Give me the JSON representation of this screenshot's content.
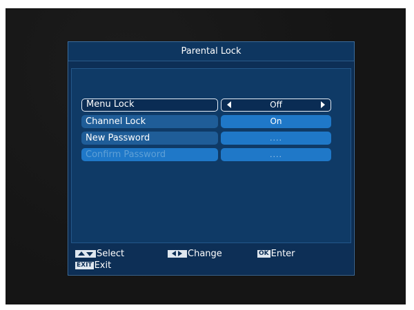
{
  "title": "Parental Lock",
  "menu": [
    {
      "label": "Menu Lock",
      "value": "Off",
      "state": "selected",
      "has_arrows": true,
      "masked": false
    },
    {
      "label": "Channel Lock",
      "value": "On",
      "state": "normal",
      "has_arrows": false,
      "masked": false
    },
    {
      "label": "New Password",
      "value": "....",
      "state": "normal",
      "has_arrows": false,
      "masked": true
    },
    {
      "label": "Confirm Password",
      "value": "....",
      "state": "disabled",
      "has_arrows": false,
      "masked": true
    }
  ],
  "footer": {
    "select": {
      "key_icon": "up-down-arrows-icon",
      "label": "Select"
    },
    "change": {
      "key_icon": "left-right-arrows-icon",
      "label": "Change"
    },
    "enter": {
      "key": "OK",
      "label": "Enter"
    },
    "exit": {
      "key": "EXIT",
      "label": "Exit"
    }
  },
  "colors": {
    "panel_bg": "#0d2f56",
    "item_bg": "#1f5d98",
    "value_bg": "#1f78c8",
    "selected_border": "#e6eef7",
    "text": "#ffffff"
  }
}
